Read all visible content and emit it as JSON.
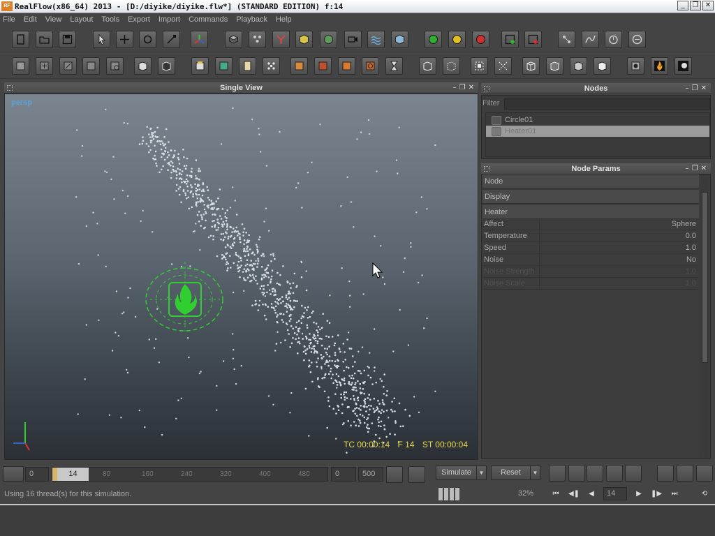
{
  "window": {
    "title": "RealFlow(x86_64) 2013 - [D:/diyike/diyike.flw*] (STANDARD EDITION) f:14",
    "app_icon_text": "RF"
  },
  "menu": [
    "File",
    "Edit",
    "View",
    "Layout",
    "Tools",
    "Export",
    "Import",
    "Commands",
    "Playback",
    "Help"
  ],
  "viewport": {
    "panel_title": "Single View",
    "camera": "persp",
    "timecode": "TC 00:00:14",
    "frame": "F 14",
    "sim_time": "ST 00:00:04"
  },
  "nodes_panel": {
    "title": "Nodes",
    "filter_label": "Filter",
    "filter_value": "",
    "items": [
      {
        "label": "Circle01",
        "selected": false
      },
      {
        "label": "Heater01",
        "selected": true
      }
    ]
  },
  "params_panel": {
    "title": "Node Params",
    "sections": [
      "Node",
      "Display",
      "Heater"
    ],
    "params": [
      {
        "name": "Affect",
        "value": "Sphere",
        "disabled": false
      },
      {
        "name": "Temperature",
        "value": "0.0",
        "disabled": false
      },
      {
        "name": "Speed",
        "value": "1.0",
        "disabled": false
      },
      {
        "name": "Noise",
        "value": "No",
        "disabled": false
      },
      {
        "name": "Noise Strength",
        "value": "1.0",
        "disabled": true
      },
      {
        "name": "Noise Scale",
        "value": "1.0",
        "disabled": true
      }
    ]
  },
  "timeline": {
    "start": "0",
    "current": "14",
    "ticks": [
      "80",
      "160",
      "240",
      "320",
      "400",
      "480"
    ],
    "range_start": "0",
    "range_end": "500",
    "simulate_label": "Simulate",
    "reset_label": "Reset"
  },
  "status": {
    "message": "Using 16 thread(s) for this simulation.",
    "progress_percent": 32,
    "progress_label": "32%",
    "frame": "14"
  },
  "colors": {
    "accent_green": "#2fcf2f",
    "hud_yellow": "#e8d84a",
    "camera_blue": "#5ba3d9"
  }
}
